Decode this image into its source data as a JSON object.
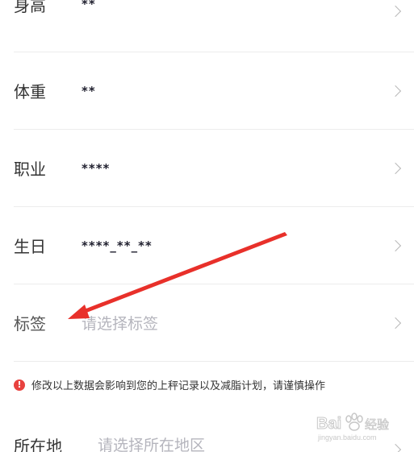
{
  "rows": {
    "height": {
      "label": "身高",
      "value": "**"
    },
    "weight": {
      "label": "体重",
      "value": "**"
    },
    "job": {
      "label": "职业",
      "value": "****"
    },
    "birthday": {
      "label": "生日",
      "value": "****_**_**"
    },
    "tags": {
      "label": "标签",
      "placeholder": "请选择标签"
    },
    "location": {
      "label": "所在地",
      "placeholder": "请选择所在地区"
    }
  },
  "warning": {
    "icon": "!",
    "text": "修改以上数据会影响到您的上秤记录以及减脂计划，请谨慎操作"
  },
  "watermark": {
    "brand": "Bai",
    "brand2": "经验",
    "url": "jingyan.baidu.com"
  },
  "colors": {
    "annotation_arrow": "#e8302a",
    "warning_icon": "#e8423f",
    "placeholder": "#b5b5bd"
  }
}
